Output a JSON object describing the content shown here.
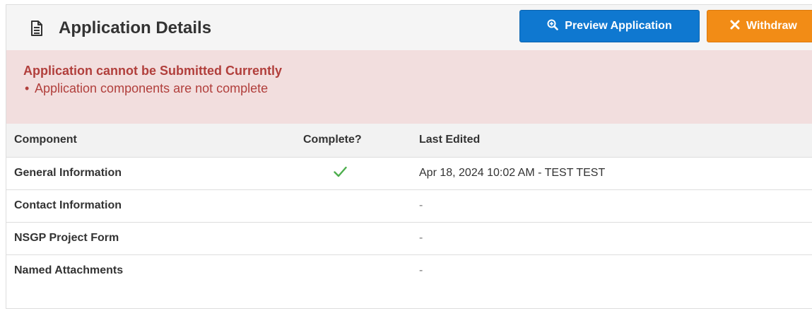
{
  "header": {
    "title": "Application Details",
    "preview_label": "Preview Application",
    "withdraw_label": "Withdraw"
  },
  "alert": {
    "heading": "Application cannot be Submitted Currently",
    "items": [
      "Application components are not complete"
    ]
  },
  "table": {
    "columns": [
      "Component",
      "Complete?",
      "Last Edited"
    ],
    "rows": [
      {
        "component": "General Information",
        "complete": true,
        "last_edited": "Apr 18, 2024 10:02 AM - TEST TEST"
      },
      {
        "component": "Contact Information",
        "complete": false,
        "last_edited": "-"
      },
      {
        "component": "NSGP Project Form",
        "complete": false,
        "last_edited": "-"
      },
      {
        "component": "Named Attachments",
        "complete": false,
        "last_edited": "-"
      }
    ]
  },
  "colors": {
    "preview_button": "#0f78d0",
    "withdraw_button": "#f28c16",
    "alert_background": "#f2dede",
    "alert_text": "#b13f3c",
    "check": "#4cae4c"
  },
  "icons": {
    "title": "document-icon",
    "preview": "zoom-in-icon",
    "withdraw": "close-icon",
    "complete": "check-icon"
  }
}
